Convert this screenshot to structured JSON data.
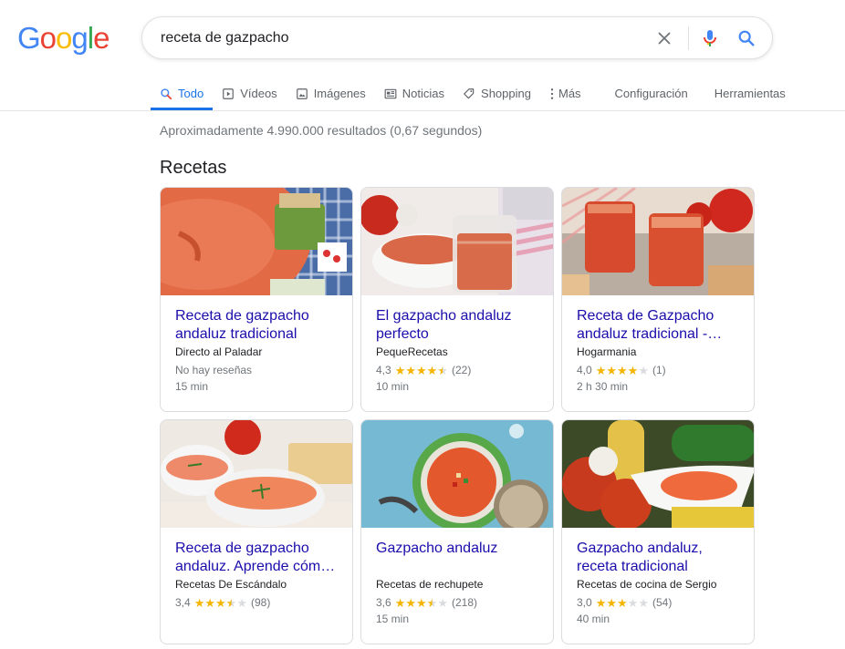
{
  "logo": {
    "letters": [
      {
        "char": "G",
        "color": "#4285F4"
      },
      {
        "char": "o",
        "color": "#EA4335"
      },
      {
        "char": "o",
        "color": "#FBBC05"
      },
      {
        "char": "g",
        "color": "#4285F4"
      },
      {
        "char": "l",
        "color": "#34A853"
      },
      {
        "char": "e",
        "color": "#EA4335"
      }
    ]
  },
  "search": {
    "value": "receta de gazpacho",
    "clear_icon": "close-icon",
    "mic_icon": "microphone-icon",
    "search_icon": "search-icon"
  },
  "tabs": [
    {
      "label": "Todo",
      "icon": "search-icon",
      "active": true
    },
    {
      "label": "Vídeos",
      "icon": "video-icon"
    },
    {
      "label": "Imágenes",
      "icon": "image-icon"
    },
    {
      "label": "Noticias",
      "icon": "news-icon"
    },
    {
      "label": "Shopping",
      "icon": "tag-icon"
    },
    {
      "label": "Más",
      "icon": "more-vert-icon"
    },
    {
      "label": "Configuración"
    },
    {
      "label": "Herramientas"
    }
  ],
  "results": {
    "stats": "Aproximadamente 4.990.000 resultados (0,67 segundos)",
    "section_title": "Recetas"
  },
  "recipes": [
    {
      "title": "Receta de gazpacho andaluz tradicional",
      "source": "Directo al Paladar",
      "rating_text": "No hay reseñas",
      "rating": null,
      "count": "",
      "time": "15 min"
    },
    {
      "title": "El gazpacho andaluz perfecto",
      "source": "PequeRecetas",
      "rating_text": "",
      "rating": 4.3,
      "rating_label": "4,3",
      "count": "(22)",
      "time": "10 min"
    },
    {
      "title": "Receta de Gazpacho andaluz tradicional -…",
      "source": "Hogarmania",
      "rating_text": "",
      "rating": 4.0,
      "rating_label": "4,0",
      "count": "(1)",
      "time": "2 h 30 min"
    },
    {
      "title": "Receta de gazpacho andaluz. Aprende cóm…",
      "source": "Recetas De Escándalo",
      "rating_text": "",
      "rating": 3.4,
      "rating_label": "3,4",
      "count": "(98)",
      "time": ""
    },
    {
      "title": "Gazpacho andaluz",
      "source": "Recetas de rechupete",
      "rating_text": "",
      "rating": 3.6,
      "rating_label": "3,6",
      "count": "(218)",
      "time": "15 min"
    },
    {
      "title": "Gazpacho andaluz, receta tradicional",
      "source": "Recetas de cocina de Sergio",
      "rating_text": "",
      "rating": 3.0,
      "rating_label": "3,0",
      "count": "(54)",
      "time": "40 min"
    }
  ],
  "colors": {
    "accent": "#1a73e8",
    "link": "#1a0dab",
    "star": "#f4b400",
    "muted": "#70757a"
  }
}
